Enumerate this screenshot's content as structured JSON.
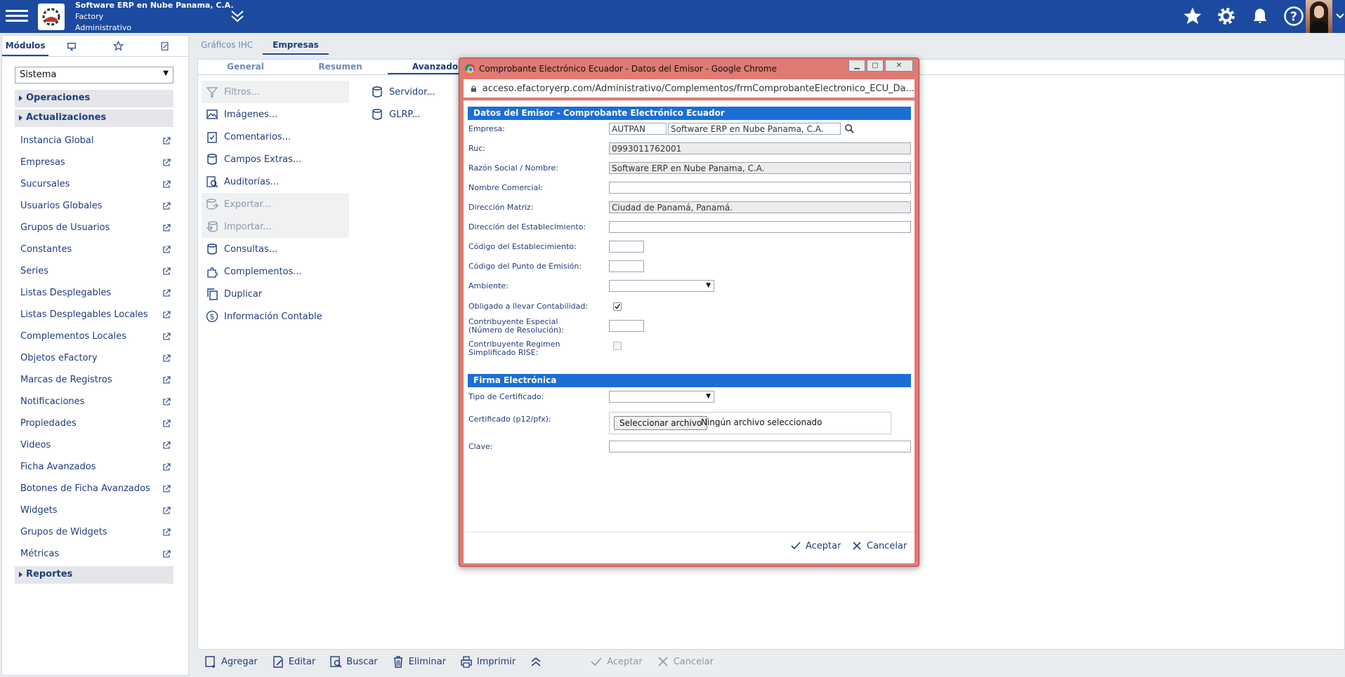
{
  "header": {
    "company_name": "Software ERP en Nube Panama, C.A.",
    "line2": "Factory",
    "line3": "Administrativo",
    "icons": [
      "menu-icon",
      "star-icon",
      "gear-icon",
      "bell-icon",
      "help-icon",
      "chevron-down-icon"
    ],
    "brand_color": "#1c4aa0"
  },
  "sidebar": {
    "tabs": [
      {
        "label": "Módulos",
        "active": true
      },
      {
        "icon": "monitor-icon"
      },
      {
        "icon": "star-icon"
      },
      {
        "icon": "edit-icon"
      }
    ],
    "select_value": "Sistema",
    "groups": {
      "operaciones": "Operaciones",
      "actualizaciones": "Actualizaciones",
      "reportes": "Reportes"
    },
    "items": [
      "Instancia Global",
      "Empresas",
      "Sucursales",
      "Usuarios Globales",
      "Grupos de Usuarios",
      "Constantes",
      "Series",
      "Listas Desplegables",
      "Listas Desplegables Locales",
      "Complementos Locales",
      "Objetos eFactory",
      "Marcas de Registros",
      "Notificaciones",
      "Propiedades",
      "Videos",
      "Ficha Avanzados",
      "Botones de Ficha Avanzados",
      "Widgets",
      "Grupos de Widgets",
      "Métricas"
    ]
  },
  "content_tabs": [
    {
      "label": "Gráficos IHC",
      "active": false
    },
    {
      "label": "Empresas",
      "active": true
    }
  ],
  "subtabs": [
    {
      "label": "General",
      "active": false
    },
    {
      "label": "Resumen",
      "active": false
    },
    {
      "label": "Avanzado",
      "active": true
    }
  ],
  "actions": [
    {
      "label": "Filtros...",
      "icon": "filter-icon",
      "disabled": true
    },
    {
      "label": "Imágenes...",
      "icon": "image-icon",
      "disabled": false
    },
    {
      "label": "Comentarios...",
      "icon": "clipboard-icon",
      "disabled": false
    },
    {
      "label": "Campos Extras...",
      "icon": "database-icon",
      "disabled": false
    },
    {
      "label": "Auditorías...",
      "icon": "audit-icon",
      "disabled": false
    },
    {
      "label": "Exportar...",
      "icon": "export-icon",
      "disabled": true
    },
    {
      "label": "Importar...",
      "icon": "import-icon",
      "disabled": true
    },
    {
      "label": "Consultas...",
      "icon": "database-icon",
      "disabled": false
    },
    {
      "label": "Complementos...",
      "icon": "puzzle-icon",
      "disabled": false
    },
    {
      "label": "Duplicar",
      "icon": "copy-icon",
      "disabled": false
    },
    {
      "label": "Información Contable",
      "icon": "dollar-icon",
      "disabled": false
    }
  ],
  "actions2": [
    {
      "label": "Servidor...",
      "icon": "database-icon"
    },
    {
      "label": "GLRP...",
      "icon": "database-icon"
    }
  ],
  "bottombar": [
    {
      "label": "Agregar",
      "icon": "add-icon",
      "disabled": false
    },
    {
      "label": "Editar",
      "icon": "edit-icon",
      "disabled": false
    },
    {
      "label": "Buscar",
      "icon": "search-icon",
      "disabled": false
    },
    {
      "label": "Eliminar",
      "icon": "trash-icon",
      "disabled": false
    },
    {
      "label": "Imprimir",
      "icon": "printer-icon",
      "disabled": false
    },
    {
      "label": "",
      "icon": "double-chevron-up-icon",
      "disabled": false
    },
    {
      "label": "Aceptar",
      "icon": "check-icon",
      "disabled": true
    },
    {
      "label": "Cancelar",
      "icon": "x-icon",
      "disabled": true
    }
  ],
  "modal": {
    "title": "Comprobante Electrónico Ecuador - Datos del Emisor - Google Chrome",
    "url": "acceso.efactoryerp.com/Administrativo/Complementos/frmComprobanteElectronico_ECU_Da...",
    "section1": "Datos del Emisor - Comprobante Electrónico Ecuador",
    "section2": "Firma Electrónica",
    "fields": {
      "empresa_label": "Empresa:",
      "empresa_code": "AUTPAN",
      "empresa_name": "Software ERP en Nube Panama, C.A.",
      "ruc_label": "Ruc:",
      "ruc_value": "0993011762001",
      "razon_label": "Razón Social / Nombre:",
      "razon_value": "Software ERP en Nube Panama, C.A.",
      "nombre_comercial_label": "Nombre Comercial:",
      "nombre_comercial_value": "",
      "direccion_matriz_label": "Dirección Matriz:",
      "direccion_matriz_value": "Ciudad de Panamá, Panamá.",
      "direccion_est_label": "Dirección del Establecimiento:",
      "direccion_est_value": "",
      "codigo_est_label": "Código del Establecimiento:",
      "codigo_punto_label": "Código del Punto de Emisión:",
      "ambiente_label": "Ambiente:",
      "ambiente_value": "",
      "obligado_label": "Obligado a llevar Contabilidad:",
      "obligado_checked": true,
      "contrib_especial_label": "Contribuyente Especial (Número de Resolución):",
      "contrib_rise_label": "Contribuyente Regimen Simplificado RISE:",
      "contrib_rise_checked": false,
      "tipo_cert_label": "Tipo de Certificado:",
      "tipo_cert_value": "",
      "certificado_label": "Certificado (p12/pfx):",
      "file_button": "Seleccionar archivo",
      "file_status": "Ningún archivo seleccionado",
      "clave_label": "Clave:",
      "clave_value": ""
    },
    "accept": "Aceptar",
    "cancel": "Cancelar",
    "window_controls": [
      "minimize-icon",
      "maximize-icon",
      "close-icon"
    ]
  }
}
